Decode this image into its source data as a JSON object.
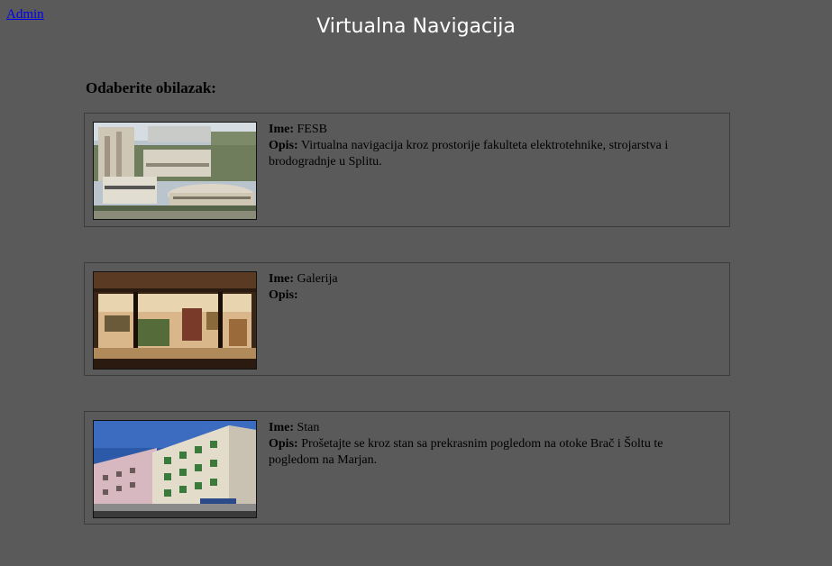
{
  "header": {
    "admin_link": "Admin",
    "title": "Virtualna Navigacija"
  },
  "main": {
    "heading": "Odaberite obilazak:",
    "name_label": "Ime:",
    "desc_label": "Opis:",
    "tours": [
      {
        "name": "FESB",
        "description": "Virtualna navigacija kroz prostorije fakulteta elektrotehnike, strojarstva i brodogradnje u Splitu.",
        "thumbnail": "fesb-building-photo"
      },
      {
        "name": "Galerija",
        "description": "",
        "thumbnail": "gallery-interior-photo"
      },
      {
        "name": "Stan",
        "description": "Prošetajte se kroz stan sa prekrasnim pogledom na otoke Brač i Šoltu te pogledom na Marjan.",
        "thumbnail": "apartment-building-photo"
      }
    ]
  },
  "colors": {
    "background": "#5a5a5a",
    "title": "#ffffff",
    "link": "#0000ee"
  }
}
